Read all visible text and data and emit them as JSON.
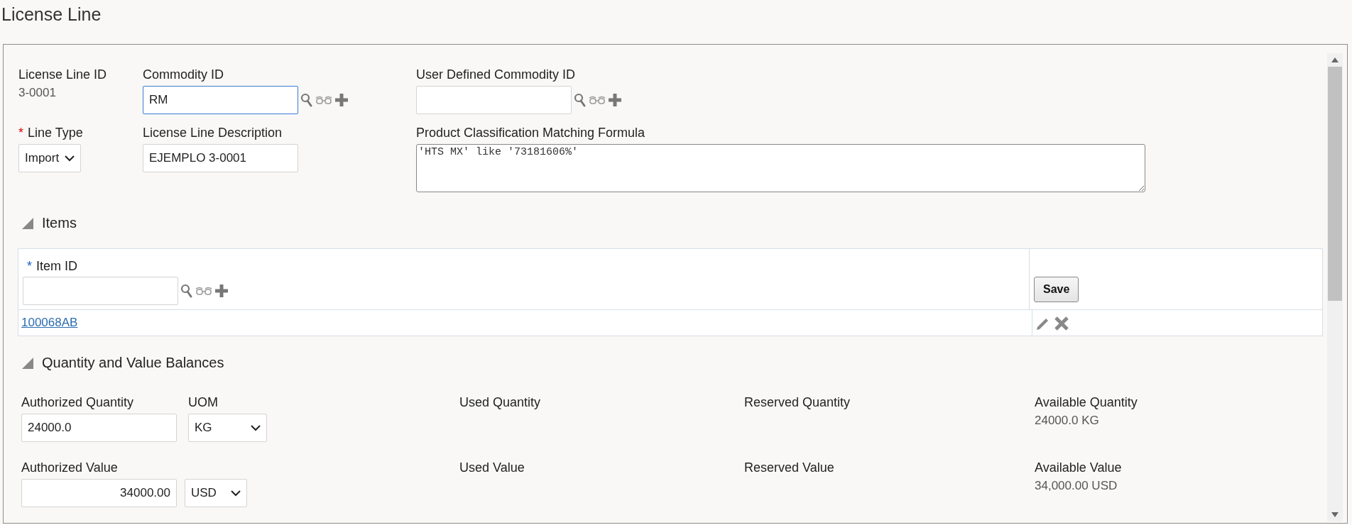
{
  "page_title": "License Line",
  "header": {
    "license_line_id": {
      "label": "License Line ID",
      "value": "3-0001"
    },
    "commodity_id": {
      "label": "Commodity ID",
      "value": "RM",
      "focused": true
    },
    "user_defined_commodity_id": {
      "label": "User Defined Commodity ID",
      "focused": false
    },
    "line_type": {
      "required_mark": "*",
      "label": "Line Type",
      "value": "Import"
    },
    "description": {
      "label": "License Line Description",
      "value": "EJEMPLO 3-0001"
    },
    "formula": {
      "label": "Product Classification Matching Formula",
      "value": "'HTS MX' like '73181606%'"
    }
  },
  "items": {
    "title": "Items",
    "expanded": true,
    "item_id": {
      "required_mark": "*",
      "label": "Item ID"
    },
    "save_button": "Save",
    "rows": [
      {
        "item": "100068AB"
      }
    ]
  },
  "balances": {
    "title": "Quantity and Value Balances",
    "expanded": true,
    "authorized_quantity": {
      "label": "Authorized Quantity",
      "value": "24000.0"
    },
    "uom": {
      "label": "UOM",
      "value": "KG"
    },
    "used_quantity": {
      "label": "Used Quantity"
    },
    "reserved_quantity": {
      "label": "Reserved Quantity"
    },
    "available_quantity": {
      "label": "Available Quantity",
      "value": "24000.0 KG"
    },
    "authorized_value": {
      "label": "Authorized Value",
      "value": "34000.00"
    },
    "currency": {
      "value": "USD"
    },
    "used_value": {
      "label": "Used Value"
    },
    "reserved_value": {
      "label": "Reserved Value"
    },
    "available_value": {
      "label": "Available Value",
      "value": "34,000.00 USD"
    }
  }
}
